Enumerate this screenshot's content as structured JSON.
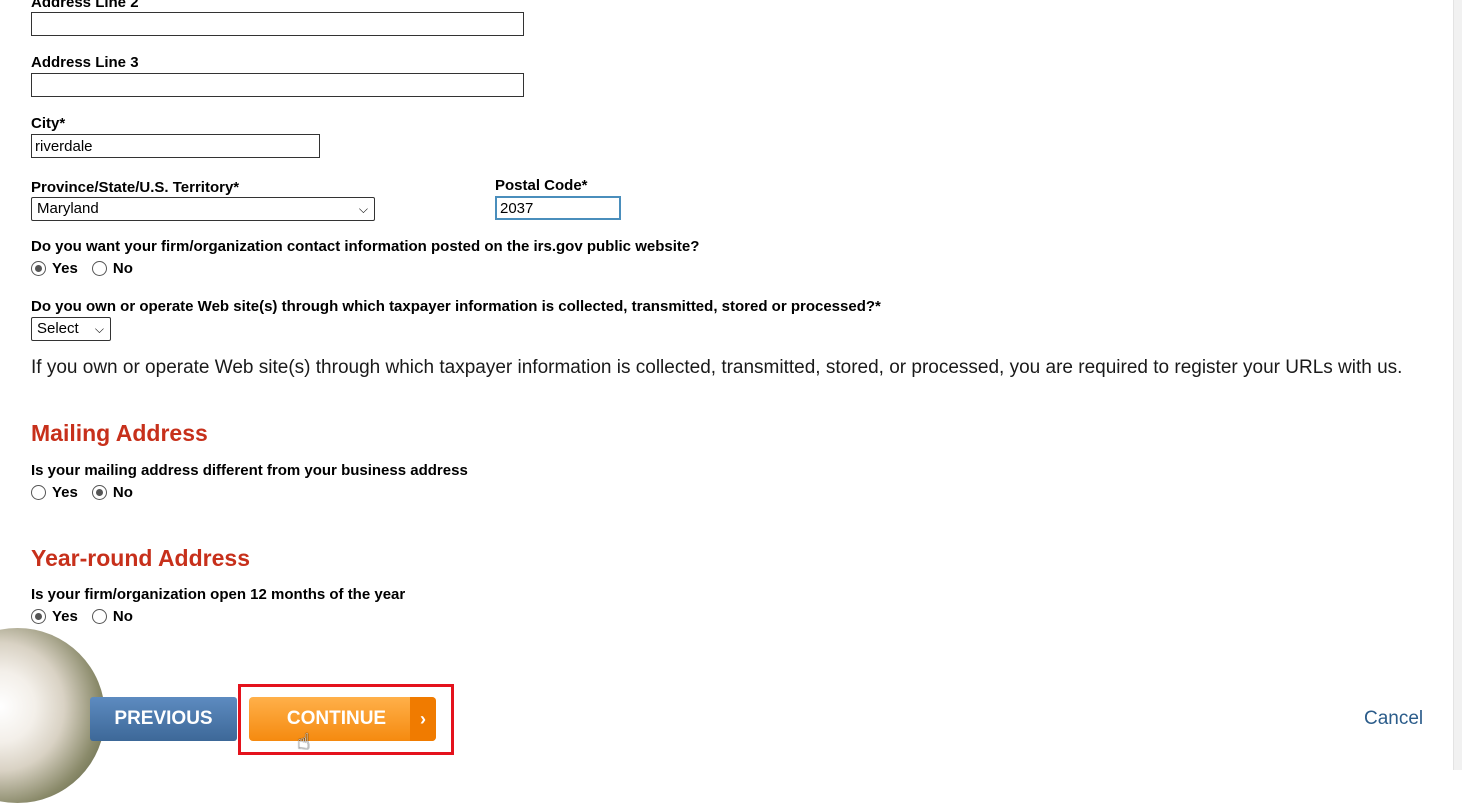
{
  "form": {
    "address_line2_label": "Address Line 2",
    "address_line2_value": "",
    "address_line3_label": "Address Line 3",
    "address_line3_value": "",
    "city_label": "City*",
    "city_value": "riverdale",
    "state_label": "Province/State/U.S. Territory*",
    "state_value": "Maryland",
    "postal_label": "Postal Code*",
    "postal_value": "2037",
    "public_question": "Do you want your firm/organization contact information posted on the irs.gov public website?",
    "public_yes": "Yes",
    "public_no": "No",
    "public_selected": "Yes",
    "website_question": "Do you own or operate Web site(s) through which taxpayer information is collected, transmitted, stored or processed?*",
    "website_select_value": "Select",
    "website_info": "If you own or operate Web site(s) through which taxpayer information is collected, transmitted, stored, or processed, you are required to register your URLs with us."
  },
  "mailing": {
    "heading": "Mailing Address",
    "question": "Is your mailing address different from your business address",
    "yes": "Yes",
    "no": "No",
    "selected": "No"
  },
  "yearround": {
    "heading": "Year-round Address",
    "question": "Is your firm/organization open 12 months of the year",
    "yes": "Yes",
    "no": "No",
    "selected": "Yes"
  },
  "buttons": {
    "previous": "PREVIOUS",
    "continue": "CONTINUE",
    "continue_arrow": "›",
    "cancel": "Cancel"
  },
  "colors": {
    "section_heading": "#c7301b",
    "previous_button": "#3d6898",
    "continue_button": "#f58a0f",
    "highlight_box": "#e4121c",
    "cancel_link": "#2b5c8a"
  }
}
